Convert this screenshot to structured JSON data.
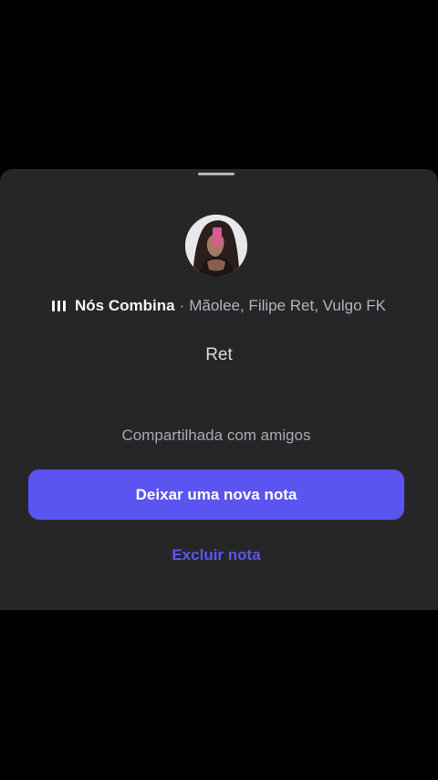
{
  "sheet": {
    "song": {
      "icon": "audio-bars-icon",
      "title": "Nós Combina",
      "separator": "·",
      "artists": "Mãolee, Filipe Ret, Vulgo FK"
    },
    "note_text": "Ret",
    "shared_label": "Compartilhada com amigos",
    "primary_button_label": "Deixar uma nova nota",
    "delete_label": "Excluir nota"
  },
  "colors": {
    "background": "#000000",
    "sheet": "#262629",
    "accent": "#5a55f1",
    "delete_link": "#5b56ec"
  }
}
